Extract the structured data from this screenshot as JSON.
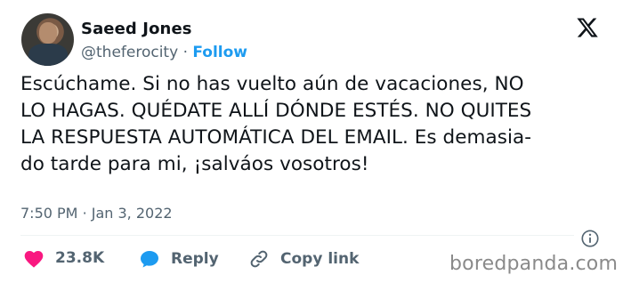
{
  "author": {
    "name": "Saeed Jones",
    "handle": "@theferocity",
    "separator": "·",
    "follow_label": "Follow"
  },
  "tweet": {
    "lines": [
      "Escúchame. Si no has vuelto aún de vacaciones, NO",
      "LO HAGAS. QUÉDATE ALLÍ DÓNDE ESTÉS. NO QUITES",
      "LA RESPUESTA AUTOMÁTICA DEL EMAIL. Es demasia-",
      "do tarde para mi, ¡salváos vosotros!"
    ],
    "time": "7:50 PM",
    "date_separator": "·",
    "date": "Jan 3, 2022"
  },
  "actions": {
    "like_count": "23.8K",
    "reply_label": "Reply",
    "copy_label": "Copy link"
  },
  "watermark": "boredpanda.com",
  "colors": {
    "link": "#1d9bf0",
    "secondary": "#536471",
    "like": "#f91880",
    "primary_text": "#0f1419"
  },
  "icons": [
    "x-logo-icon",
    "info-icon",
    "heart-icon",
    "reply-bubble-icon",
    "link-icon"
  ]
}
